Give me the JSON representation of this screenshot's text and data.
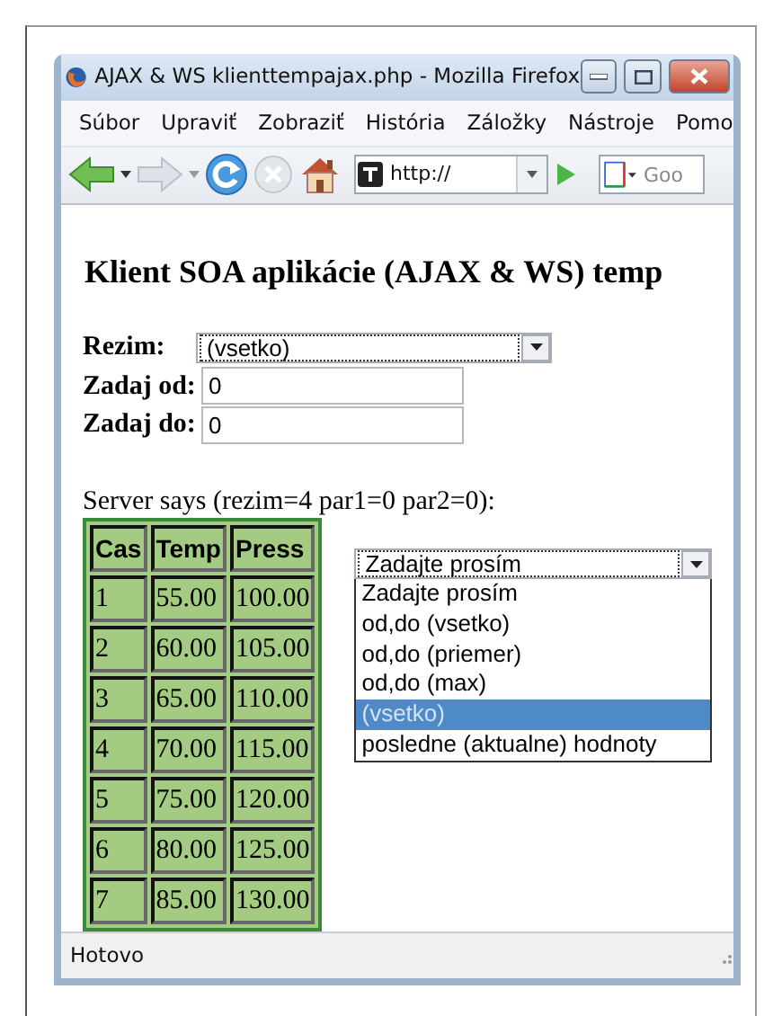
{
  "window": {
    "title": "AJAX & WS klienttempajax.php - Mozilla Firefox"
  },
  "menu": [
    {
      "label": "Súbor"
    },
    {
      "label": "Upraviť"
    },
    {
      "label": "Zobraziť"
    },
    {
      "label": "História"
    },
    {
      "label": "Záložky"
    },
    {
      "label": "Nástroje"
    },
    {
      "label": "Pomo"
    }
  ],
  "toolbar": {
    "url": "http://",
    "search_placeholder": "Goo"
  },
  "page": {
    "heading": "Klient SOA aplikácie (AJAX & WS) temp",
    "form": [
      {
        "kind": "select",
        "label": "Rezim:",
        "value": "(vsetko)"
      },
      {
        "kind": "input",
        "label": "Zadaj od:",
        "value": "0"
      },
      {
        "kind": "input",
        "label": "Zadaj do:",
        "value": "0"
      }
    ],
    "server_says": "Server says (rezim=4 par1=0 par2=0):",
    "table": {
      "columns": [
        "Cas",
        "Temp",
        "Press"
      ],
      "rows": [
        [
          "1",
          "55.00",
          "100.00"
        ],
        [
          "2",
          "60.00",
          "105.00"
        ],
        [
          "3",
          "65.00",
          "110.00"
        ],
        [
          "4",
          "70.00",
          "115.00"
        ],
        [
          "5",
          "75.00",
          "120.00"
        ],
        [
          "6",
          "80.00",
          "125.00"
        ],
        [
          "7",
          "85.00",
          "130.00"
        ]
      ]
    },
    "dropdown": {
      "value": "Zadajte prosím",
      "expanded": true,
      "options": [
        {
          "label": "Zadajte prosím",
          "highlighted": false
        },
        {
          "label": "od,do (vsetko)",
          "highlighted": false
        },
        {
          "label": "od,do (priemer)",
          "highlighted": false
        },
        {
          "label": "od,do (max)",
          "highlighted": false
        },
        {
          "label": "(vsetko)",
          "highlighted": true
        },
        {
          "label": "posledne (aktualne) hodnoty",
          "highlighted": false
        }
      ]
    }
  },
  "status_bar": {
    "text": "Hotovo"
  }
}
